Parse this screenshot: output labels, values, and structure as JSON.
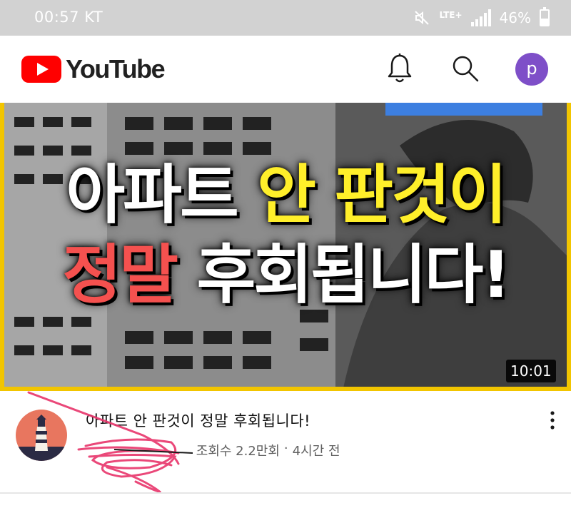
{
  "status_bar": {
    "time": "00:57 KT",
    "network": "LTE+",
    "battery": "46%",
    "icons": [
      "mute-icon",
      "signal-icon",
      "battery-icon"
    ]
  },
  "app_bar": {
    "logo_text": "YouTube",
    "avatar_letter": "p",
    "icons": [
      "notification-bell-icon",
      "search-icon"
    ],
    "colors": {
      "logo_red": "#ff0000",
      "avatar": "#7e4fc8"
    }
  },
  "video": {
    "thumbnail_line1_white": "아파트",
    "thumbnail_line1_yellow": "안 판것이",
    "thumbnail_line2_red": "정말",
    "thumbnail_line2_white": "후회됩니다!",
    "duration": "10:01",
    "title": "아파트 안 판것이 정말 후회됩니다!",
    "views": "조회수 2.2만회",
    "separator": "·",
    "age": "4시간 전",
    "colors": {
      "frame": "#f2c500",
      "highlight_yellow": "#ffef2a",
      "highlight_red": "#f5514f"
    }
  }
}
